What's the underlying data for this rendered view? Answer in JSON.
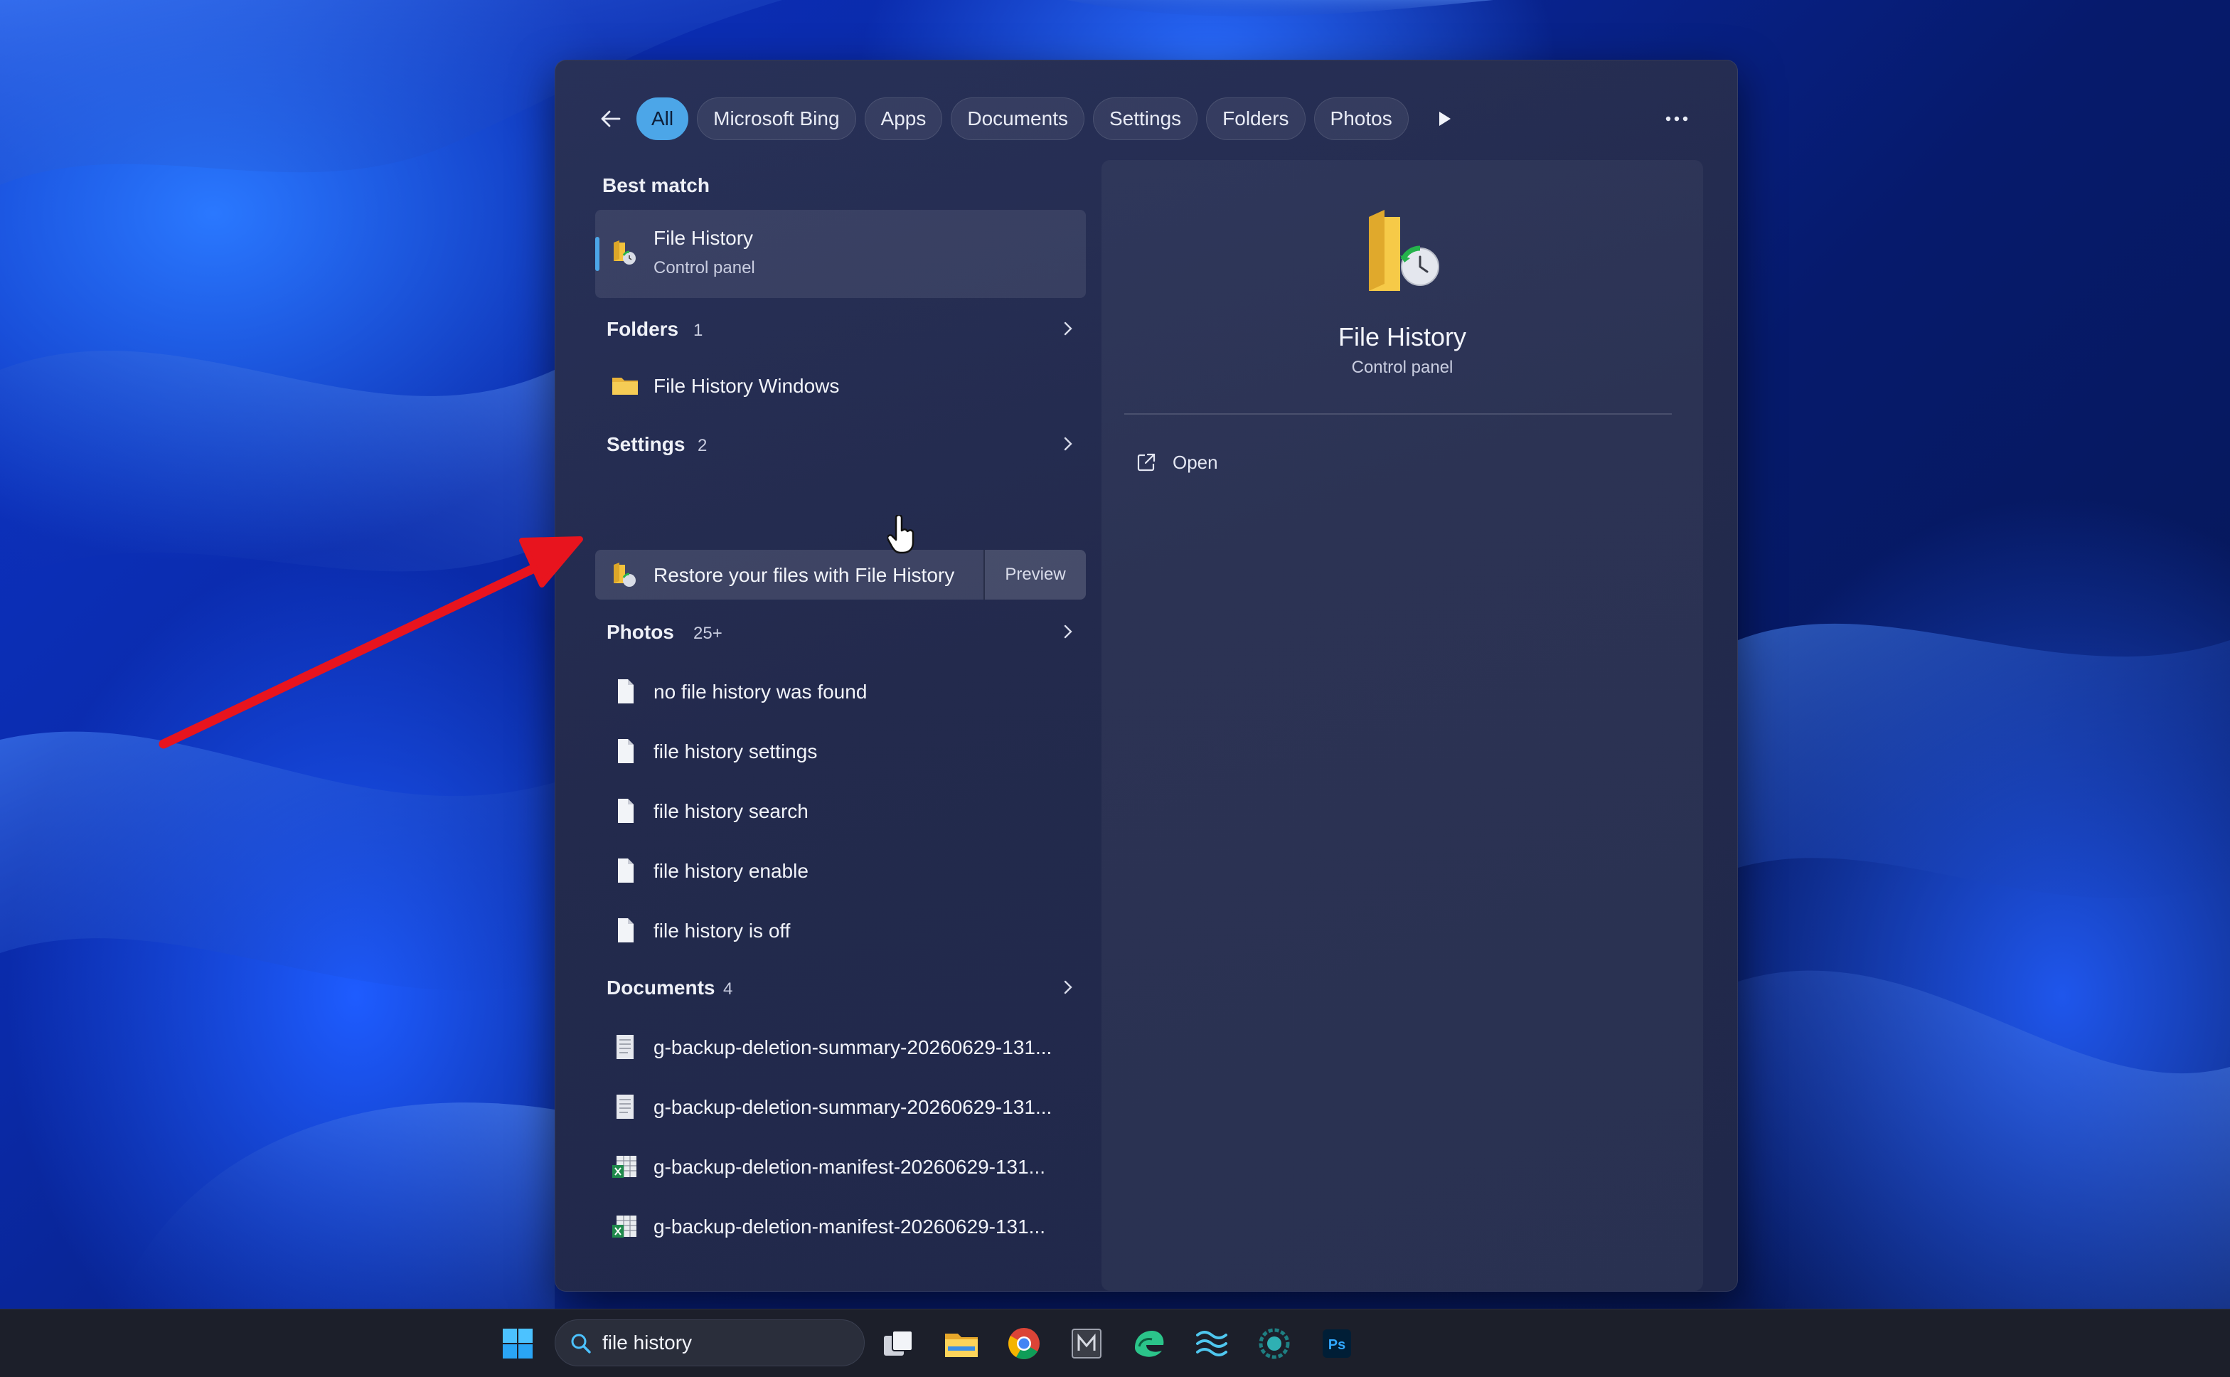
{
  "filters": {
    "back_label": "Back",
    "chips": [
      {
        "label": "All",
        "active": true
      },
      {
        "label": "Microsoft Bing",
        "active": false
      },
      {
        "label": "Apps",
        "active": false
      },
      {
        "label": "Documents",
        "active": false
      },
      {
        "label": "Settings",
        "active": false
      },
      {
        "label": "Folders",
        "active": false
      },
      {
        "label": "Photos",
        "active": false
      }
    ]
  },
  "best_match": {
    "section_label": "Best match",
    "title": "File History",
    "subtitle": "Control panel",
    "icon": "file-history-icon"
  },
  "groups": {
    "folders": {
      "label": "Folders",
      "count": "1",
      "items": [
        {
          "label": "File History Windows",
          "icon": "folder-icon"
        }
      ]
    },
    "settings": {
      "label": "Settings",
      "count": "2",
      "items": [
        {
          "label": "Restore your files with File History",
          "icon": "file-history-icon",
          "preview_label": "Preview"
        }
      ]
    },
    "photos": {
      "label": "Photos",
      "count": "25+",
      "items": [
        {
          "label": "no file history was found",
          "icon": "document-icon"
        },
        {
          "label": "file history settings",
          "icon": "document-icon"
        },
        {
          "label": "file history search",
          "icon": "document-icon"
        },
        {
          "label": "file history enable",
          "icon": "document-icon"
        },
        {
          "label": "file history is off",
          "icon": "document-icon"
        }
      ]
    },
    "documents": {
      "label": "Documents",
      "count": "4",
      "items": [
        {
          "label": "g-backup-deletion-summary-20260629-131...",
          "icon": "text-file-icon"
        },
        {
          "label": "g-backup-deletion-summary-20260629-131...",
          "icon": "text-file-icon"
        },
        {
          "label": "g-backup-deletion-manifest-20260629-131...",
          "icon": "spreadsheet-icon"
        },
        {
          "label": "g-backup-deletion-manifest-20260629-131...",
          "icon": "spreadsheet-icon"
        }
      ]
    }
  },
  "preview": {
    "title": "File History",
    "subtitle": "Control panel",
    "actions": [
      {
        "label": "Open",
        "icon": "open-external-icon"
      }
    ]
  },
  "taskbar": {
    "search_value": "file history",
    "apps": [
      "windows-start-icon",
      "task-view-icon",
      "file-explorer-icon",
      "chrome-icon",
      "app-m-icon",
      "edge-dev-icon",
      "wave-app-icon",
      "circle-app-icon",
      "photoshop-icon"
    ],
    "photoshop_text": "Ps"
  },
  "colors": {
    "accent": "#4ca6e8",
    "annotation_arrow": "#e8141e",
    "panel_bg": "#252c50",
    "taskbar_bg": "#1c1f2a"
  }
}
